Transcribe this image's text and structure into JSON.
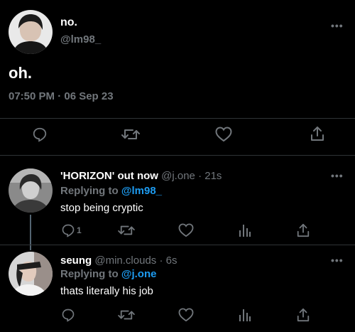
{
  "main_tweet": {
    "display_name": "no.",
    "handle": "@lm98_",
    "text": "oh.",
    "timestamp": "07:50 PM · 06 Sep 23",
    "more_label": "•••",
    "actions": [
      "reply-icon",
      "retweet-icon",
      "like-icon",
      "share-icon"
    ]
  },
  "replies": [
    {
      "display_name": "'HORIZON' out now",
      "handle": "@j.one",
      "time": "· 21s",
      "replying_label": "Replying to",
      "replying_to": "@lm98_",
      "text": "stop being cryptic",
      "reply_count": "1",
      "more_label": "•••"
    },
    {
      "display_name": "seung",
      "handle": "@min.clouds",
      "time": "· 6s",
      "replying_label": "Replying to",
      "replying_to": "@j.one",
      "text": "thats literally his job",
      "reply_count": "",
      "more_label": "•••"
    }
  ],
  "colors": {
    "background": "#000000",
    "secondary_text": "#71767b",
    "accent": "#1d9bf0",
    "divider": "#2f3336"
  }
}
